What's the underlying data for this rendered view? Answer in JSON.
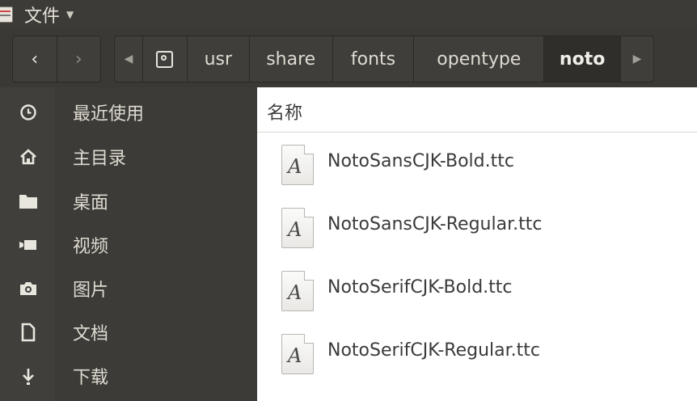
{
  "menubar": {
    "app_menu_label": "文件"
  },
  "toolbar": {
    "back_icon": "‹",
    "forward_icon": "›",
    "scroll_left_icon": "◀",
    "scroll_right_icon": "▶",
    "breadcrumbs": [
      "usr",
      "share",
      "fonts",
      "opentype",
      "noto"
    ]
  },
  "sidebar": {
    "items": [
      {
        "label": "最近使用",
        "icon": "clock-icon"
      },
      {
        "label": "主目录",
        "icon": "home-icon"
      },
      {
        "label": "桌面",
        "icon": "folder-icon"
      },
      {
        "label": "视频",
        "icon": "video-icon"
      },
      {
        "label": "图片",
        "icon": "camera-icon"
      },
      {
        "label": "文档",
        "icon": "document-icon"
      },
      {
        "label": "下载",
        "icon": "download-icon"
      }
    ]
  },
  "main": {
    "column_header": "名称",
    "files": [
      {
        "name": "NotoSansCJK-Bold.ttc",
        "icon": "font-file-icon"
      },
      {
        "name": "NotoSansCJK-Regular.ttc",
        "icon": "font-file-icon"
      },
      {
        "name": "NotoSerifCJK-Bold.ttc",
        "icon": "font-file-icon"
      },
      {
        "name": "NotoSerifCJK-Regular.ttc",
        "icon": "font-file-icon"
      }
    ]
  }
}
